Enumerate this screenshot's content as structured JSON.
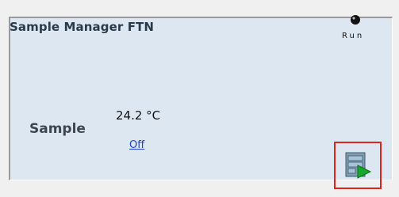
{
  "module": {
    "title": "Sample Manager FTN",
    "status_label": "Run",
    "status_icon": "run-status-dot-icon",
    "temperature_label": "Sample",
    "temperature_value": "24.2 °C",
    "temperature_control_link": "Off",
    "action_icon": "instrument-play-icon"
  },
  "colors": {
    "panel_background": "#dde7f2",
    "highlight_border": "#e2231a",
    "link": "#1a3fd0",
    "play_green": "#18a82a"
  }
}
